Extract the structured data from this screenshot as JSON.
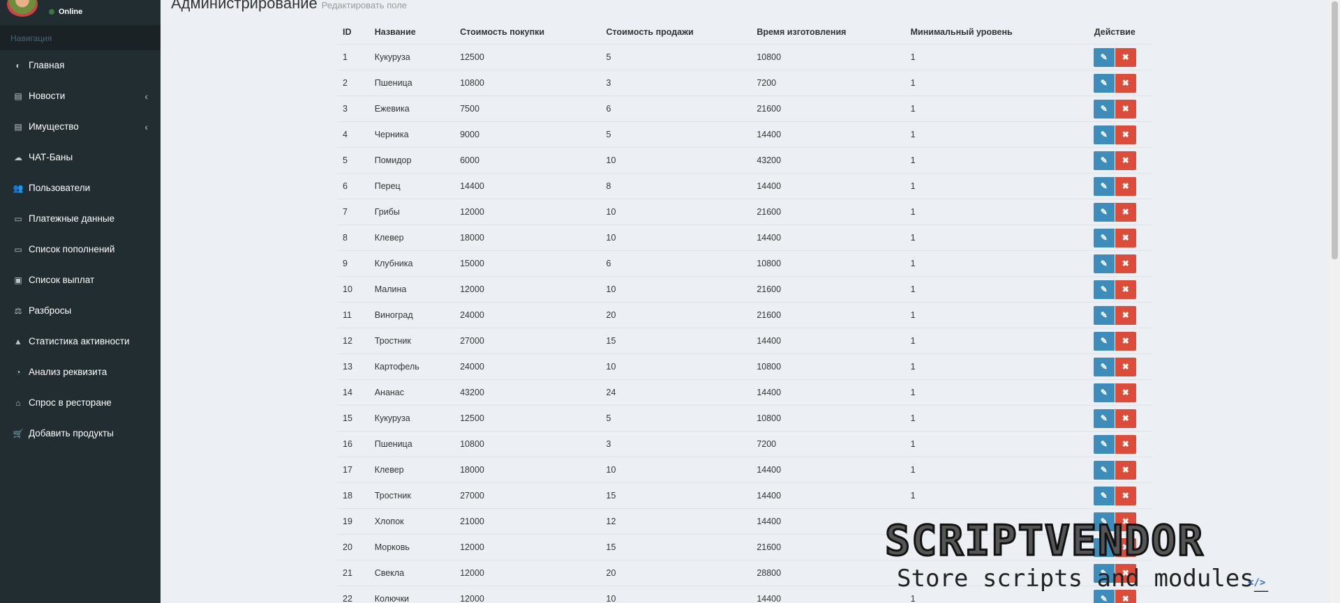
{
  "sidebar": {
    "status": "Online",
    "nav_header": "Навигация",
    "items": [
      {
        "label": "Главная",
        "icon": "dashboard-icon",
        "glyph": "◐",
        "chevron": false
      },
      {
        "label": "Новости",
        "icon": "newspaper-icon",
        "glyph": "▤",
        "chevron": true
      },
      {
        "label": "Имущество",
        "icon": "newspaper-icon",
        "glyph": "▤",
        "chevron": true
      },
      {
        "label": "ЧАТ-Баны",
        "icon": "comments-icon",
        "glyph": "☁",
        "chevron": false
      },
      {
        "label": "Пользователи",
        "icon": "users-icon",
        "glyph": "👥",
        "chevron": false
      },
      {
        "label": "Платежные данные",
        "icon": "credit-card-icon",
        "glyph": "▭",
        "chevron": false
      },
      {
        "label": "Список пополнений",
        "icon": "credit-card-icon",
        "glyph": "▭",
        "chevron": false
      },
      {
        "label": "Список выплат",
        "icon": "money-icon",
        "glyph": "▣",
        "chevron": false
      },
      {
        "label": "Разбросы",
        "icon": "balance-scale-icon",
        "glyph": "⚖",
        "chevron": false
      },
      {
        "label": "Статистика активности",
        "icon": "area-chart-icon",
        "glyph": "▲",
        "chevron": false
      },
      {
        "label": "Анализ реквизита",
        "icon": "pie-chart-icon",
        "glyph": "◔",
        "chevron": false
      },
      {
        "label": "Спрос в ресторане",
        "icon": "bank-icon",
        "glyph": "⌂",
        "chevron": false
      },
      {
        "label": "Добавить продукты",
        "icon": "shopping-cart-icon",
        "glyph": "🛒",
        "chevron": false
      }
    ]
  },
  "page": {
    "title": "Администрирование",
    "subtitle": "Редактировать поле"
  },
  "table": {
    "headers": [
      "ID",
      "Название",
      "Стоимость покупки",
      "Стоимость продажи",
      "Время изготовления",
      "Минимальный уровень",
      "Действие"
    ],
    "rows": [
      [
        "1",
        "Кукуруза",
        "12500",
        "5",
        "10800",
        "1"
      ],
      [
        "2",
        "Пшеница",
        "10800",
        "3",
        "7200",
        "1"
      ],
      [
        "3",
        "Ежевика",
        "7500",
        "6",
        "21600",
        "1"
      ],
      [
        "4",
        "Черника",
        "9000",
        "5",
        "14400",
        "1"
      ],
      [
        "5",
        "Помидор",
        "6000",
        "10",
        "43200",
        "1"
      ],
      [
        "6",
        "Перец",
        "14400",
        "8",
        "14400",
        "1"
      ],
      [
        "7",
        "Грибы",
        "12000",
        "10",
        "21600",
        "1"
      ],
      [
        "8",
        "Клевер",
        "18000",
        "10",
        "14400",
        "1"
      ],
      [
        "9",
        "Клубника",
        "15000",
        "6",
        "10800",
        "1"
      ],
      [
        "10",
        "Малина",
        "12000",
        "10",
        "21600",
        "1"
      ],
      [
        "11",
        "Виноград",
        "24000",
        "20",
        "21600",
        "1"
      ],
      [
        "12",
        "Тростник",
        "27000",
        "15",
        "14400",
        "1"
      ],
      [
        "13",
        "Картофель",
        "24000",
        "10",
        "10800",
        "1"
      ],
      [
        "14",
        "Ананас",
        "43200",
        "24",
        "14400",
        "1"
      ],
      [
        "15",
        "Кукуруза",
        "12500",
        "5",
        "10800",
        "1"
      ],
      [
        "16",
        "Пшеница",
        "10800",
        "3",
        "7200",
        "1"
      ],
      [
        "17",
        "Клевер",
        "18000",
        "10",
        "14400",
        "1"
      ],
      [
        "18",
        "Тростник",
        "27000",
        "15",
        "14400",
        "1"
      ],
      [
        "19",
        "Хлопок",
        "21000",
        "12",
        "14400",
        ""
      ],
      [
        "20",
        "Морковь",
        "12000",
        "15",
        "21600",
        ""
      ],
      [
        "21",
        "Свекла",
        "12000",
        "20",
        "28800",
        ""
      ],
      [
        "22",
        "Колючки",
        "12000",
        "10",
        "14400",
        "1"
      ]
    ],
    "edit_glyph": "✎",
    "delete_glyph": "✖"
  },
  "watermark": {
    "title": "SCRIPTVENDOR",
    "subtitle": "Store scripts and modules_"
  },
  "colors": {
    "sidebar": "#222d32",
    "edit": "#3c8dbc",
    "delete": "#dd4b39",
    "background": "#ecf0f5"
  }
}
